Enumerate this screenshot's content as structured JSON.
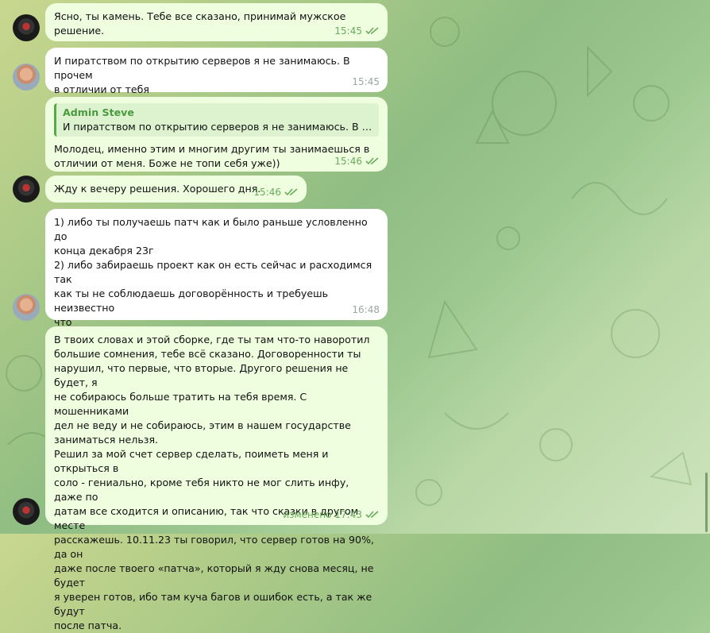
{
  "messages": [
    {
      "id": "m1",
      "type": "out",
      "text": "Ясно, ты камень. Тебе все сказано, принимай мужское решение.",
      "time": "15:45",
      "read": true
    },
    {
      "id": "m2",
      "type": "in",
      "text": "И пиратством по открытию серверов я не занимаюсь. В прочем\nв отличии от тебя",
      "time": "15:45"
    },
    {
      "id": "m3",
      "type": "out",
      "reply": {
        "name": "Admin Steve",
        "text": "И пиратством по открытию серверов я не занимаюсь. В про..."
      },
      "text": "Молодец, именно этим и многим другим ты занимаешься в\nотличии от меня. Боже не топи себя уже))",
      "time": "15:46",
      "read": true
    },
    {
      "id": "m4",
      "type": "out",
      "text": "Жду к вечеру решения. Хорошего дня.",
      "time": "15:46",
      "read": true
    },
    {
      "id": "m5",
      "type": "in",
      "text": "1) либо ты получаешь патч как и было раньше условленно до\nконца декабря 23г\n2) либо забираешь проект как он есть сейчас и расходимся так\nкак ты не соблюдаешь договорённость и требуешь неизвестно\nчто\nПроект не мой который ты указал\nМне скрывать нечего",
      "time": "16:48"
    },
    {
      "id": "m6",
      "type": "out",
      "text": "В твоих словах и этой сборке, где ты там что-то наворотил\nбольшие сомнения, тебе всё сказано. Договоренности ты\nнарушил, что первые, что вторые. Другого решения не будет, я\nне собираюсь больше тратить на тебя время. С мошенниками\nдел не веду и не собираюсь, этим в нашем государстве\nзаниматься нельзя.\nРешил за мой счет сервер сделать, поиметь меня и открыться в\nсоло - гениально, кроме тебя никто не мог слить инфу, даже по\nдатам все сходится и описанию, так что сказки в другом месте\nрасскажешь. 10.11.23 ты говорил, что сервер готов на 90%, да он\nдаже после твоего «патча», который я жду снова месяц, не будет\nя уверен готов, ибо там куча багов и ошибок есть, а так же будут\nпосле патча.",
      "edited": "изменено",
      "time": "17:43",
      "read": true
    }
  ]
}
